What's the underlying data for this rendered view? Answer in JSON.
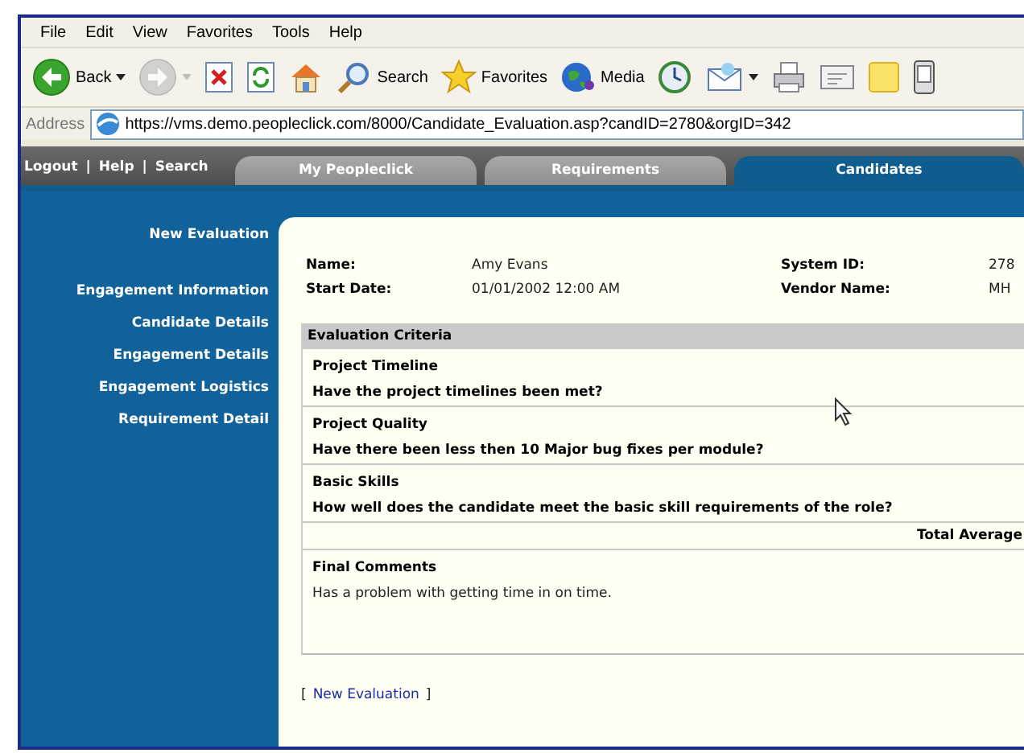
{
  "menu": [
    "File",
    "Edit",
    "View",
    "Favorites",
    "Tools",
    "Help"
  ],
  "toolbar": [
    {
      "kind": "back",
      "label": "Back",
      "dropdown": true,
      "disabled": false
    },
    {
      "kind": "forward",
      "dropdown": true,
      "disabled": true
    },
    {
      "kind": "stop",
      "dropdown": false,
      "disabled": false
    },
    {
      "kind": "refresh",
      "dropdown": false,
      "disabled": false
    },
    {
      "kind": "home",
      "dropdown": false,
      "disabled": false
    },
    {
      "kind": "search",
      "label": "Search",
      "dropdown": false,
      "disabled": false
    },
    {
      "kind": "favorites",
      "label": "Favorites",
      "dropdown": false,
      "disabled": false
    },
    {
      "kind": "media",
      "label": "Media",
      "dropdown": false,
      "disabled": false
    },
    {
      "kind": "history",
      "dropdown": false,
      "disabled": false
    },
    {
      "kind": "mail",
      "dropdown": true,
      "disabled": false
    },
    {
      "kind": "print",
      "dropdown": false,
      "disabled": false
    },
    {
      "kind": "edit",
      "dropdown": false,
      "disabled": false
    },
    {
      "kind": "note",
      "dropdown": false,
      "disabled": false
    },
    {
      "kind": "device",
      "dropdown": false,
      "disabled": false
    }
  ],
  "address": {
    "label": "Address",
    "url": "https://vms.demo.peopleclick.com/8000/Candidate_Evaluation.asp?candID=2780&orgID=342"
  },
  "site_nav": {
    "links": [
      "Logout",
      "Help",
      "Search"
    ],
    "separators": [
      "|",
      "|"
    ]
  },
  "tabs": [
    {
      "label": "My Peopleclick",
      "selected": false
    },
    {
      "label": "Requirements",
      "selected": false
    },
    {
      "label": "Candidates",
      "selected": true
    }
  ],
  "sidebar": {
    "top": "New Evaluation",
    "items": [
      "Engagement Information",
      "Candidate Details",
      "Engagement Details",
      "Engagement Logistics",
      "Requirement Detail"
    ]
  },
  "candidate": [
    {
      "label": "Name:",
      "value": "Amy Evans"
    },
    {
      "label": "System ID:",
      "value": "278"
    },
    {
      "label": "Start Date:",
      "value": "01/01/2002 12:00 AM"
    },
    {
      "label": "Vendor Name:",
      "value": "MH"
    }
  ],
  "evaluation": {
    "heading": "Evaluation Criteria",
    "criteria": [
      {
        "title": "Project Timeline",
        "question": "Have the project timelines been met?"
      },
      {
        "title": "Project Quality",
        "question": "Have there been less then 10 Major bug fixes per module?"
      },
      {
        "title": "Basic Skills",
        "question": "How well does the candidate meet the basic skill requirements of the role?"
      }
    ],
    "total_label": "Total Average",
    "comments": {
      "title": "Final Comments",
      "text": "Has a problem with getting time in on time."
    }
  },
  "footer": {
    "open": "[",
    "link": "New Evaluation",
    "close": "]"
  }
}
